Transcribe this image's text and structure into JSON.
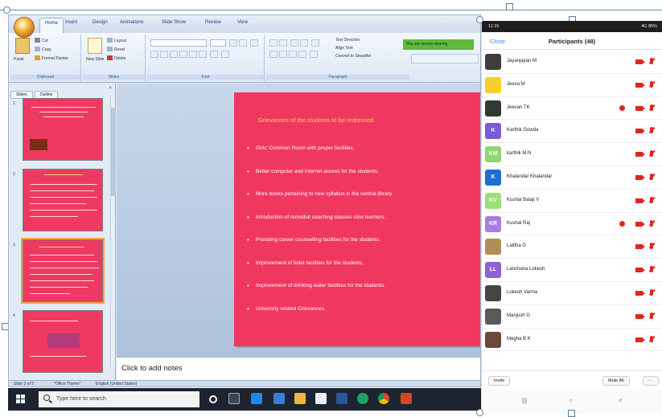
{
  "ppt": {
    "tabs": [
      "Home",
      "Insert",
      "Design",
      "Animations",
      "Slide Show",
      "Review",
      "View"
    ],
    "ribbon": {
      "clipboard": {
        "paste": "Paste",
        "cut": "Cut",
        "copy": "Copy",
        "format_painter": "Format Painter",
        "label": "Clipboard"
      },
      "slides": {
        "new_slide": "New Slide",
        "layout": "Layout",
        "reset": "Reset",
        "delete": "Delete",
        "label": "Slides"
      },
      "font": {
        "label": "Font"
      },
      "paragraph": {
        "text_direction": "Text Direction",
        "align_text": "Align Text",
        "convert_smartart": "Convert to SmartArt",
        "label": "Paragraph"
      },
      "notification": "You are screen sharing"
    },
    "slides_panel": {
      "tabs": [
        "Slides",
        "Outline"
      ],
      "close": "×",
      "numbers": [
        "1",
        "2",
        "3",
        "4"
      ]
    },
    "slide": {
      "title": "Grievances of the students to be redressed",
      "bullets": [
        "Girls' Common Room with proper facilities.",
        "Better computer and internet access for the students.",
        "More books pertaining to new syllabus in the central library.",
        "Introduction of remedial coaching classes slow learners.",
        "Providing career counselling facilities for the students.",
        "Improvement of toilet facilities for the students.",
        "Improvement of drinking water facilities for the students.",
        "University related Grievances."
      ]
    },
    "notes_placeholder": "Click to add notes",
    "status": {
      "slide_of": "Slide 3 of 5",
      "theme": "\"Office Theme\"",
      "language": "English (United States)"
    }
  },
  "taskbar": {
    "search_placeholder": "Type here to search",
    "icons": [
      "task-view-icon",
      "cortana-icon",
      "file-explorer-icon",
      "mail-icon",
      "folder-icon",
      "store-icon",
      "photos-icon",
      "edge-icon",
      "chrome-icon",
      "powerpoint-icon"
    ]
  },
  "phone": {
    "status_time": "11:15",
    "status_right": "4G 85%",
    "close": "Close",
    "title": "Participants (48)",
    "participants": [
      {
        "name": "Jayanjayan M",
        "initials": "",
        "color": "#3d3d3d",
        "hand": false
      },
      {
        "name": "Jeeva M",
        "initials": "",
        "color": "#f6cf2b",
        "hand": false
      },
      {
        "name": "Jeevan TK",
        "initials": "",
        "color": "#2f3b2f",
        "hand": true
      },
      {
        "name": "Karthik Gowda",
        "initials": "K",
        "color": "#7a5cd6",
        "hand": false
      },
      {
        "name": "karthik M.N",
        "initials": "KM",
        "color": "#8fd672",
        "hand": false
      },
      {
        "name": "Khalandar Khalandar",
        "initials": "K",
        "color": "#1f6fd1",
        "hand": false
      },
      {
        "name": "Kushal Balaji V",
        "initials": "KV",
        "color": "#9ae07a",
        "hand": false
      },
      {
        "name": "Kushal Raj",
        "initials": "KR",
        "color": "#a57ee0",
        "hand": true
      },
      {
        "name": "Lalitha G",
        "initials": "",
        "color": "#b08d57",
        "hand": false
      },
      {
        "name": "Lanchana Lokesh",
        "initials": "LL",
        "color": "#8b63d3",
        "hand": false
      },
      {
        "name": "Lokesh Varma",
        "initials": "",
        "color": "#444444",
        "hand": false
      },
      {
        "name": "Manjush G",
        "initials": "",
        "color": "#595959",
        "hand": false
      },
      {
        "name": "Megha B K",
        "initials": "",
        "color": "#6b4a3a",
        "hand": false
      }
    ],
    "invite": "Invite",
    "mute_all": "Mute All",
    "more": "···",
    "nav": [
      "|||",
      "○",
      "<"
    ]
  },
  "colors": {
    "slide_bg": "#f0385f",
    "slide_title": "#f5d36b",
    "zoom_blue": "#2d8cff",
    "muted_red": "#e1251b"
  }
}
